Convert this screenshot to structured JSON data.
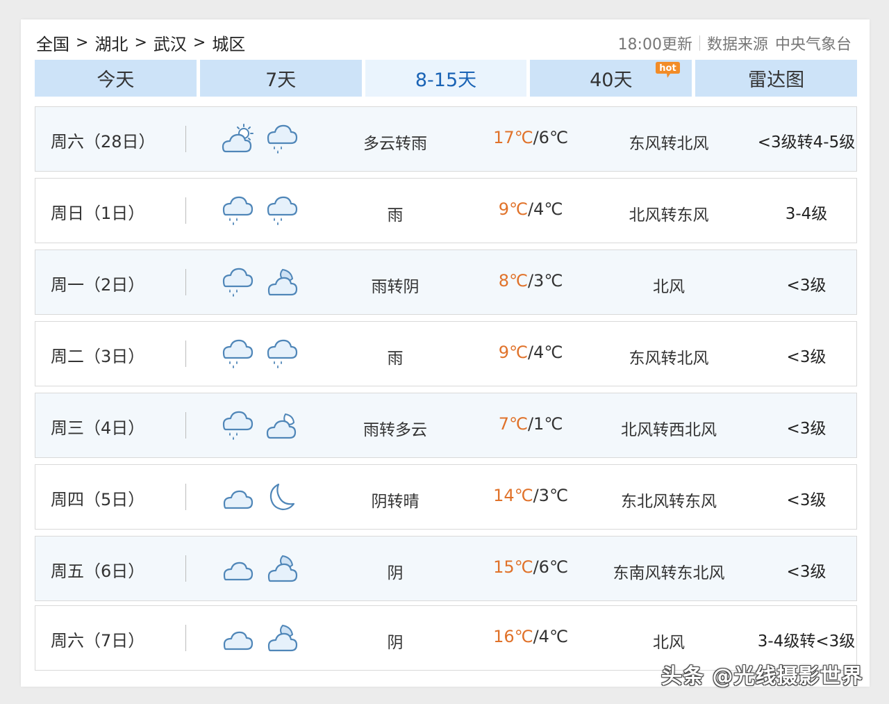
{
  "breadcrumb": {
    "items": [
      "全国",
      "湖北",
      "武汉",
      "城区"
    ],
    "separator": ">"
  },
  "meta": {
    "updated": "18:00更新",
    "source_label": "数据来源",
    "source": "中央气象台"
  },
  "tabs": [
    {
      "label": "今天",
      "active": false
    },
    {
      "label": "7天",
      "active": false
    },
    {
      "label": "8-15天",
      "active": true
    },
    {
      "label": "40天",
      "active": false,
      "badge": "hot"
    },
    {
      "label": "雷达图",
      "active": false
    }
  ],
  "forecast": [
    {
      "day": "周六（28日）",
      "icon_day": "partly-cloudy-sun-icon",
      "icon_night": "rain-icon",
      "condition": "多云转雨",
      "high": "17℃",
      "sep": "/",
      "low": "6℃",
      "wind": "东风转北风",
      "level": "<3级转4-5级"
    },
    {
      "day": "周日（1日）",
      "icon_day": "rain-icon",
      "icon_night": "rain-icon",
      "condition": "雨",
      "high": "9℃",
      "sep": "/",
      "low": "4℃",
      "wind": "北风转东风",
      "level": "3-4级"
    },
    {
      "day": "周一（2日）",
      "icon_day": "rain-icon",
      "icon_night": "cloud-moon-icon",
      "condition": "雨转阴",
      "high": "8℃",
      "sep": "/",
      "low": "3℃",
      "wind": "北风",
      "level": "<3级"
    },
    {
      "day": "周二（3日）",
      "icon_day": "rain-icon",
      "icon_night": "rain-icon",
      "condition": "雨",
      "high": "9℃",
      "sep": "/",
      "low": "4℃",
      "wind": "东风转北风",
      "level": "<3级"
    },
    {
      "day": "周三（4日）",
      "icon_day": "rain-icon",
      "icon_night": "partly-cloudy-moon-icon",
      "condition": "雨转多云",
      "high": "7℃",
      "sep": "/",
      "low": "1℃",
      "wind": "北风转西北风",
      "level": "<3级"
    },
    {
      "day": "周四（5日）",
      "icon_day": "cloud-icon",
      "icon_night": "moon-icon",
      "condition": "阴转晴",
      "high": "14℃",
      "sep": "/",
      "low": "3℃",
      "wind": "东北风转东风",
      "level": "<3级"
    },
    {
      "day": "周五（6日）",
      "icon_day": "cloud-icon",
      "icon_night": "cloud-moon-icon",
      "condition": "阴",
      "high": "15℃",
      "sep": "/",
      "low": "6℃",
      "wind": "东南风转东北风",
      "level": "<3级"
    },
    {
      "day": "周六（7日）",
      "icon_day": "cloud-icon",
      "icon_night": "cloud-moon-icon",
      "condition": "阴",
      "high": "16℃",
      "sep": "/",
      "low": "4℃",
      "wind": "北风",
      "level": "3-4级转<3级"
    }
  ],
  "colors": {
    "tab_bg": "#cde3f8",
    "tab_active_bg": "#eaf4fd",
    "tab_active_text": "#1a63b5",
    "high_temp": "#e0722a",
    "icon_stroke": "#4f86b8",
    "icon_fill": "#e6f1fb",
    "hot_badge": "#f28c28"
  },
  "watermark": "头条 @光线摄影世界"
}
